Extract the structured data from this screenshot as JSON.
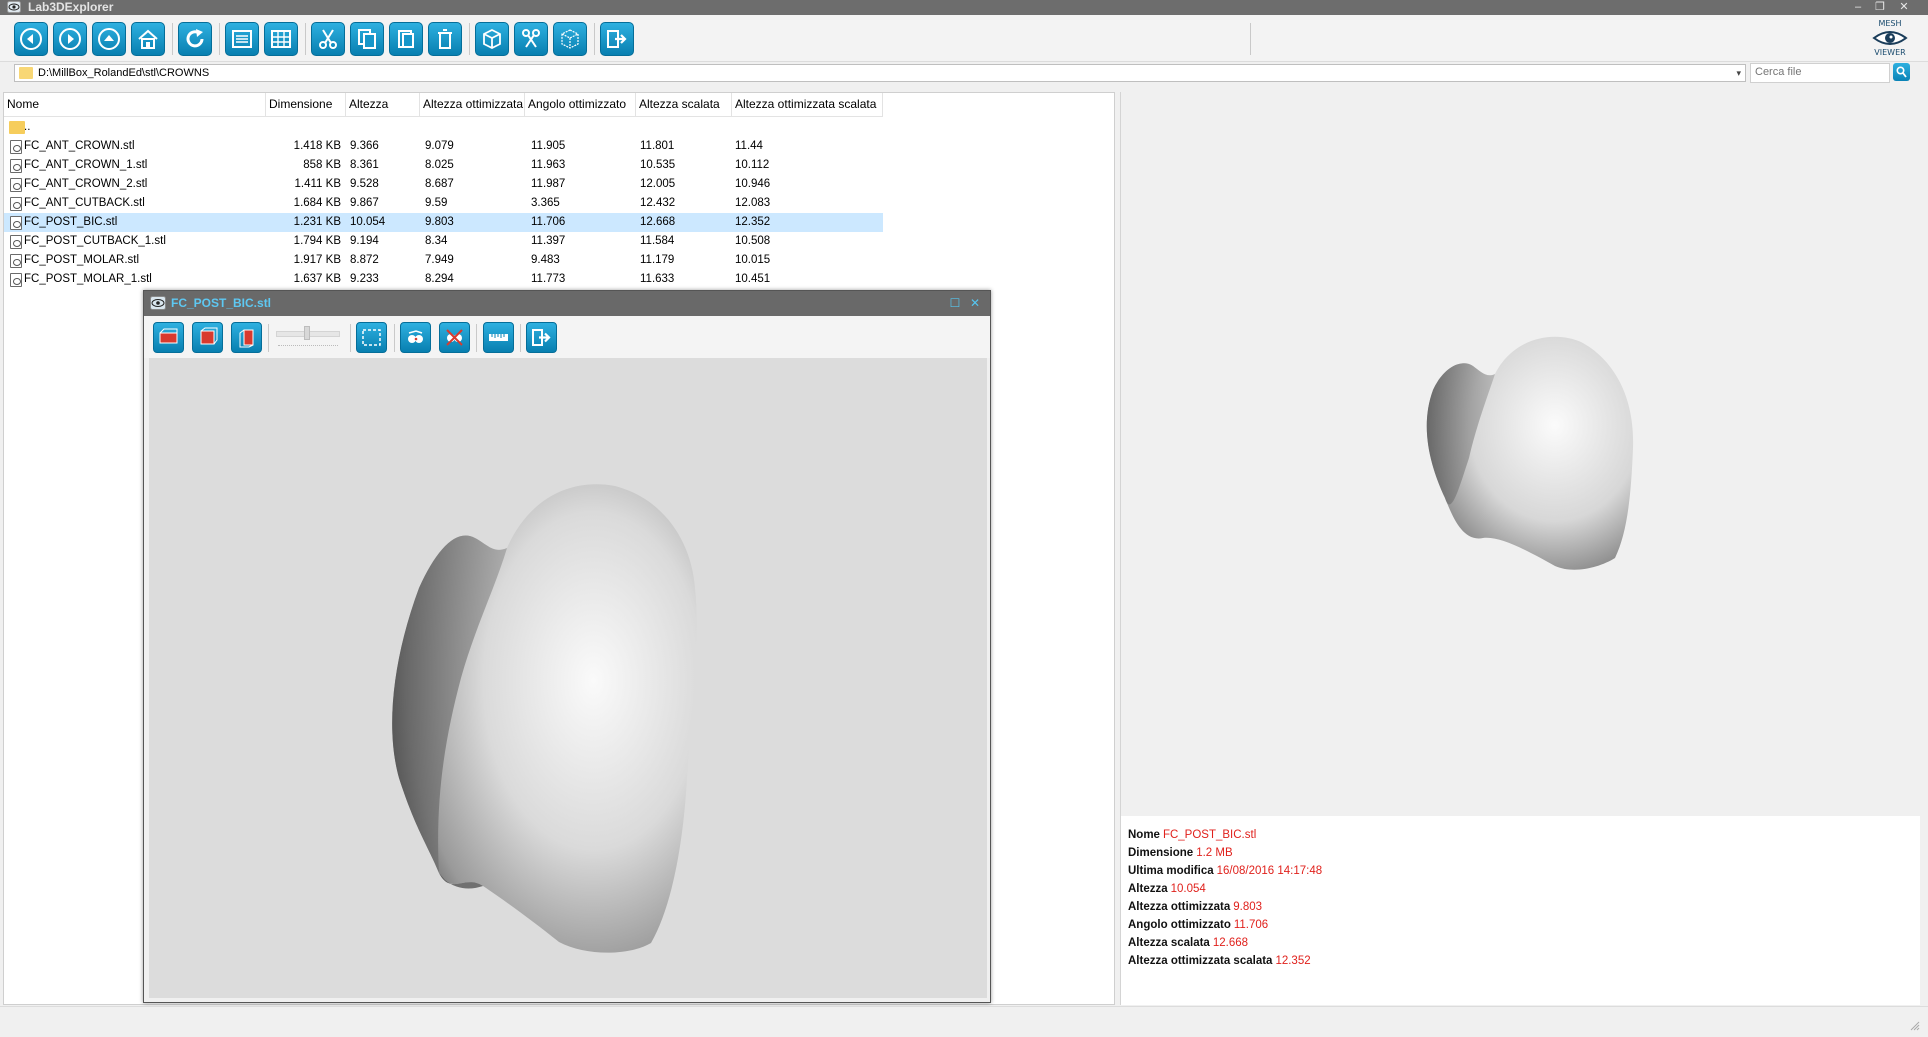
{
  "app": {
    "title": "Lab3DExplorer"
  },
  "window_controls": {
    "minimize": "–",
    "maximize": "❐",
    "close": "✕"
  },
  "toolbar": {
    "buttons": [
      "back",
      "forward",
      "up",
      "home",
      "refresh",
      "details-view",
      "list-view",
      "cut",
      "copy",
      "paste",
      "delete",
      "cube",
      "tools",
      "box",
      "exit"
    ],
    "brand_top": "MESH",
    "brand_bottom": "VIEWER"
  },
  "path": {
    "value": "D:\\MillBox_RolandEd\\stl\\CROWNS"
  },
  "search": {
    "placeholder": "Cerca file"
  },
  "columns": [
    "Nome",
    "Dimensione",
    "Altezza",
    "Altezza ottimizzata",
    "Angolo ottimizzato",
    "Altezza scalata",
    "Altezza ottimizzata scalata"
  ],
  "rows": [
    {
      "name": "..",
      "folder": true,
      "size": "",
      "h": "",
      "ho": "",
      "ao": "",
      "hs": "",
      "hos": ""
    },
    {
      "name": "FC_ANT_CROWN.stl",
      "size": "1.418 KB",
      "h": "9.366",
      "ho": "9.079",
      "ao": "11.905",
      "hs": "11.801",
      "hos": "11.44"
    },
    {
      "name": "FC_ANT_CROWN_1.stl",
      "size": "858 KB",
      "h": "8.361",
      "ho": "8.025",
      "ao": "11.963",
      "hs": "10.535",
      "hos": "10.112"
    },
    {
      "name": "FC_ANT_CROWN_2.stl",
      "size": "1.411 KB",
      "h": "9.528",
      "ho": "8.687",
      "ao": "11.987",
      "hs": "12.005",
      "hos": "10.946"
    },
    {
      "name": "FC_ANT_CUTBACK.stl",
      "size": "1.684 KB",
      "h": "9.867",
      "ho": "9.59",
      "ao": "3.365",
      "hs": "12.432",
      "hos": "12.083"
    },
    {
      "name": "FC_POST_BIC.stl",
      "size": "1.231 KB",
      "h": "10.054",
      "ho": "9.803",
      "ao": "11.706",
      "hs": "12.668",
      "hos": "12.352",
      "selected": true
    },
    {
      "name": "FC_POST_CUTBACK_1.stl",
      "size": "1.794 KB",
      "h": "9.194",
      "ho": "8.34",
      "ao": "11.397",
      "hs": "11.584",
      "hos": "10.508"
    },
    {
      "name": "FC_POST_MOLAR.stl",
      "size": "1.917 KB",
      "h": "8.872",
      "ho": "7.949",
      "ao": "9.483",
      "hs": "11.179",
      "hos": "10.015"
    },
    {
      "name": "FC_POST_MOLAR_1.stl",
      "size": "1.637 KB",
      "h": "9.233",
      "ho": "8.294",
      "ao": "11.773",
      "hs": "11.633",
      "hos": "10.451"
    }
  ],
  "info": [
    {
      "label": "Nome",
      "value": "FC_POST_BIC.stl"
    },
    {
      "label": "Dimensione",
      "value": "1.2 MB"
    },
    {
      "label": "Ultima modifica",
      "value": "16/08/2016 14:17:48"
    },
    {
      "label": "Altezza",
      "value": "10.054"
    },
    {
      "label": "Altezza ottimizzata",
      "value": "9.803"
    },
    {
      "label": "Angolo ottimizzato",
      "value": "11.706"
    },
    {
      "label": "Altezza scalata",
      "value": "12.668"
    },
    {
      "label": "Altezza ottimizzata scalata",
      "value": "12.352"
    }
  ],
  "viewer": {
    "title": "FC_POST_BIC.stl",
    "maximize": "☐",
    "close": "✕",
    "tools": [
      "front-view",
      "top-view",
      "side-view",
      "zoom-slider",
      "fit-view",
      "rotate",
      "measure",
      "ruler",
      "exit"
    ]
  },
  "colors": {
    "accent": "#0e8fc3",
    "selected_row": "#cce8ff",
    "info_value": "#e0211c",
    "titlebar": "#6d6d6d"
  }
}
